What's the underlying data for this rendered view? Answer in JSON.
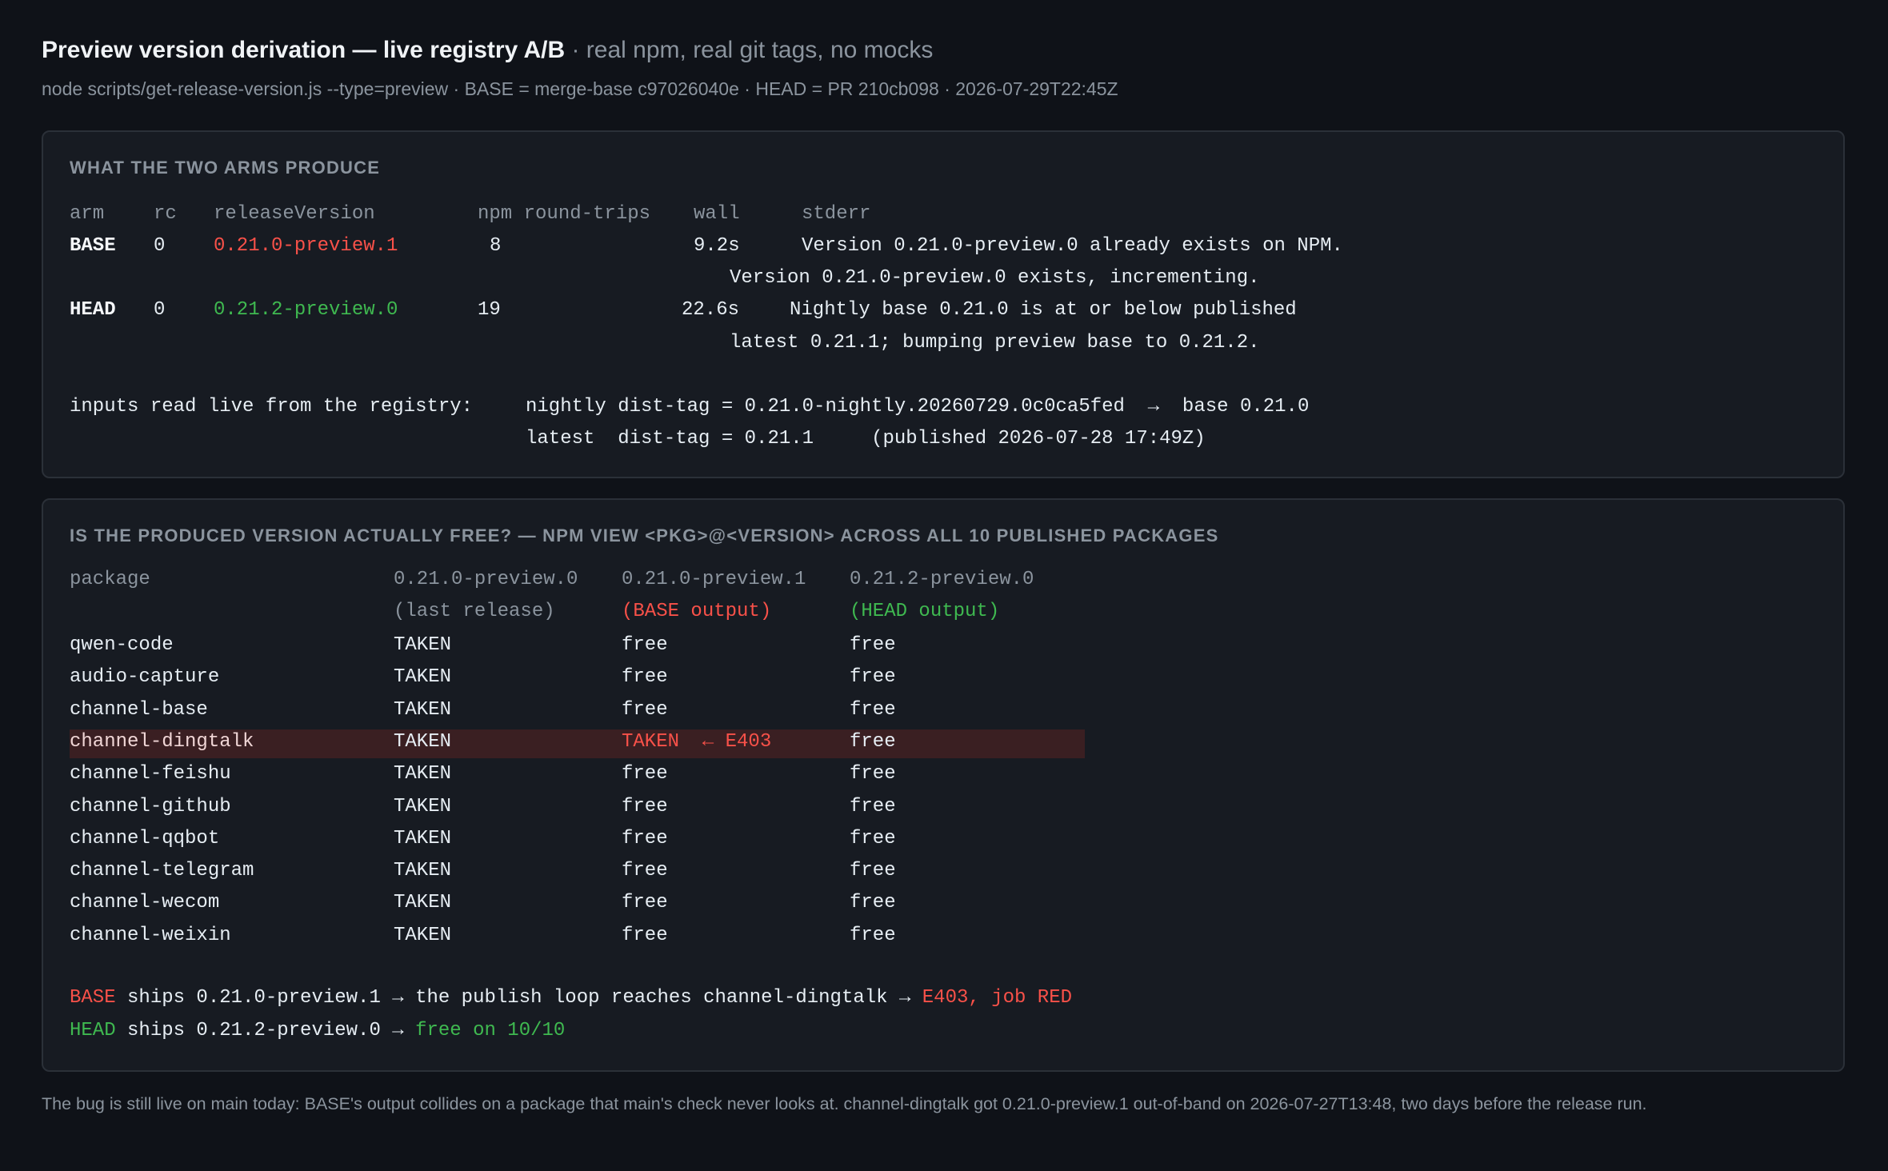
{
  "header": {
    "title": "Preview version derivation — live registry A/B",
    "subtitle": " · real npm, real git tags, no mocks",
    "command_line": "node scripts/get-release-version.js --type=preview  ·  BASE = merge-base c97026040e  ·  HEAD = PR 210cb098  ·  2026-07-29T22:45Z"
  },
  "arms_panel": {
    "label": "WHAT THE TWO ARMS PRODUCE",
    "columns": {
      "arm": "arm",
      "rc": "rc",
      "release_version": "releaseVersion",
      "npm_round_trips": "npm round-trips",
      "wall": "wall",
      "stderr": "stderr"
    },
    "rows": [
      {
        "arm": "BASE",
        "rc": "0",
        "release_version": "0.21.0-preview.1",
        "npm_round_trips": "8",
        "wall": "9.2s",
        "stderr_line1": "Version 0.21.0-preview.0 already exists on NPM.",
        "stderr_line2": "Version 0.21.0-preview.0 exists, incrementing."
      },
      {
        "arm": "HEAD",
        "rc": "0",
        "release_version": "0.21.2-preview.0",
        "npm_round_trips": "19",
        "wall": "22.6s",
        "stderr_line1": "Nightly base 0.21.0 is at or below published",
        "stderr_line2": "latest 0.21.1; bumping preview base to 0.21.2."
      }
    ],
    "inputs_label": "inputs read live from the registry:",
    "inputs_line1": "nightly dist-tag = 0.21.0-nightly.20260729.0c0ca5fed  →  base 0.21.0",
    "inputs_line2": "latest  dist-tag = 0.21.1     (published 2026-07-28 17:49Z)"
  },
  "check_panel": {
    "label": "IS THE PRODUCED VERSION ACTUALLY FREE? — NPM VIEW <PKG>@<VERSION> ACROSS ALL 10 PUBLISHED PACKAGES",
    "columns": {
      "package": "package",
      "v1": "0.21.0-preview.0",
      "v1_note": "(last release)",
      "v2": "0.21.0-preview.1",
      "v2_note": "(BASE output)",
      "v3": "0.21.2-preview.0",
      "v3_note": "(HEAD output)"
    },
    "rows": [
      {
        "package": "qwen-code",
        "v1": "TAKEN",
        "v2": "free",
        "v3": "free"
      },
      {
        "package": "audio-capture",
        "v1": "TAKEN",
        "v2": "free",
        "v3": "free"
      },
      {
        "package": "channel-base",
        "v1": "TAKEN",
        "v2": "free",
        "v3": "free"
      },
      {
        "package": "channel-dingtalk",
        "v1": "TAKEN",
        "v2": "TAKEN  ← E403",
        "v3": "free"
      },
      {
        "package": "channel-feishu",
        "v1": "TAKEN",
        "v2": "free",
        "v3": "free"
      },
      {
        "package": "channel-github",
        "v1": "TAKEN",
        "v2": "free",
        "v3": "free"
      },
      {
        "package": "channel-qqbot",
        "v1": "TAKEN",
        "v2": "free",
        "v3": "free"
      },
      {
        "package": "channel-telegram",
        "v1": "TAKEN",
        "v2": "free",
        "v3": "free"
      },
      {
        "package": "channel-wecom",
        "v1": "TAKEN",
        "v2": "free",
        "v3": "free"
      },
      {
        "package": "channel-weixin",
        "v1": "TAKEN",
        "v2": "free",
        "v3": "free"
      }
    ],
    "summary": {
      "base_arm": "BASE",
      "base_text": " ships 0.21.0-preview.1 → the publish loop reaches channel-dingtalk → ",
      "base_result": "E403, job RED",
      "head_arm": "HEAD",
      "head_text": " ships 0.21.2-preview.0 → ",
      "head_result": "free on 10/10"
    }
  },
  "footnote": "The bug is still live on main today: BASE's output collides on a package that main's check never looks at. channel-dingtalk got 0.21.0-preview.1 out-of-band on 2026-07-27T13:48, two days before the release run.",
  "colors": {
    "background": "#0f1218",
    "panel": "#171b22",
    "red": "#f85149",
    "green": "#3fb950",
    "muted": "#8b949e",
    "highlight_row": "#3a1f22"
  }
}
